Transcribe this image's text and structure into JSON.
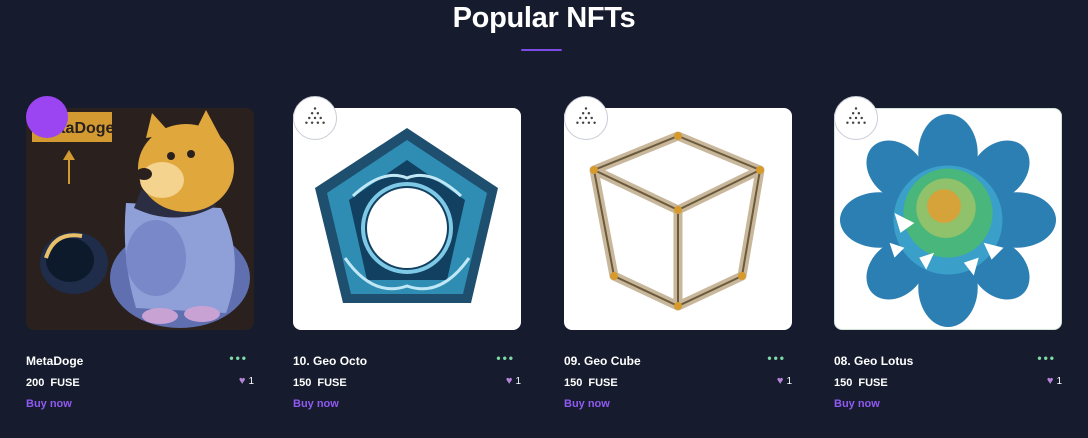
{
  "section": {
    "title": "Popular NFTs"
  },
  "cards": [
    {
      "name": "MetaDoge",
      "price": "200",
      "currency": "FUSE",
      "likes": "1",
      "buy_label": "Buy now",
      "more": "•••",
      "image_tag": "MetaDoge",
      "image_icon": "doge-illustration",
      "avatar_color": "#9b45f2"
    },
    {
      "name": "10. Geo Octo",
      "price": "150",
      "currency": "FUSE",
      "likes": "1",
      "buy_label": "Buy now",
      "more": "•••",
      "image_icon": "geo-pentagon-art"
    },
    {
      "name": "09. Geo Cube",
      "price": "150",
      "currency": "FUSE",
      "likes": "1",
      "buy_label": "Buy now",
      "more": "•••",
      "image_icon": "geo-cube-art"
    },
    {
      "name": "08. Geo Lotus",
      "price": "150",
      "currency": "FUSE",
      "likes": "1",
      "buy_label": "Buy now",
      "more": "•••",
      "image_icon": "geo-lotus-art"
    }
  ],
  "colors": {
    "background": "#161c2d",
    "accent": "#7b4be6",
    "link": "#8f59f2",
    "heart": "#b685d9",
    "dots": "#7fd9a6"
  }
}
